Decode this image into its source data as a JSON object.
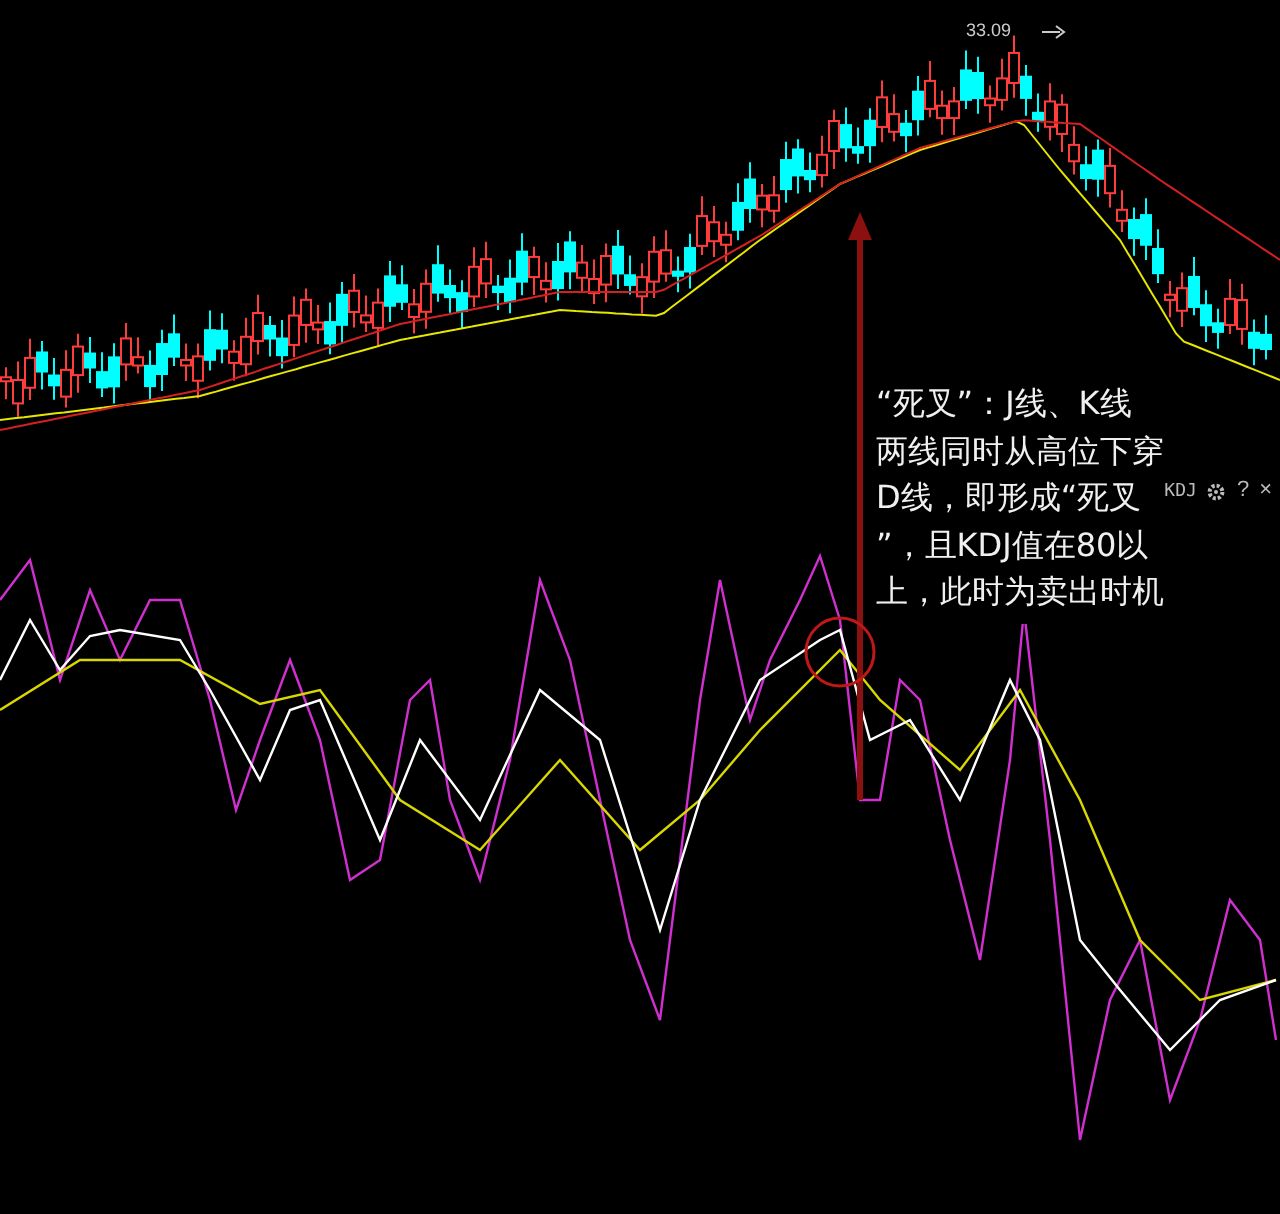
{
  "price_chart": {
    "high_label": "33.09"
  },
  "annotation": {
    "lines": [
      "“死叉”：J线、K线",
      "两线同时从高位下穿",
      "D线，即形成“死叉",
      "”，且KDJ值在80以",
      "上，此时为卖出时机"
    ]
  },
  "indicator_bar": {
    "name": "KDJ",
    "help": "?",
    "close": "×"
  }
}
